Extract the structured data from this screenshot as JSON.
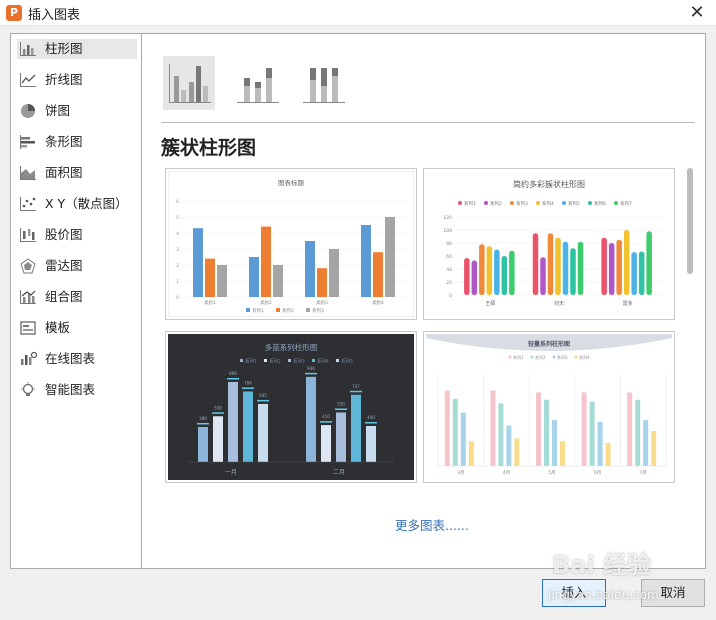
{
  "window": {
    "title": "插入图表"
  },
  "sidebar": {
    "items": [
      {
        "label": "柱形图",
        "icon": "bar-chart-icon"
      },
      {
        "label": "折线图",
        "icon": "line-chart-icon"
      },
      {
        "label": "饼图",
        "icon": "pie-chart-icon"
      },
      {
        "label": "条形图",
        "icon": "horizontal-bar-icon"
      },
      {
        "label": "面积图",
        "icon": "area-chart-icon"
      },
      {
        "label": "X Y（散点图）",
        "icon": "scatter-chart-icon"
      },
      {
        "label": "股价图",
        "icon": "stock-chart-icon"
      },
      {
        "label": "雷达图",
        "icon": "radar-chart-icon"
      },
      {
        "label": "组合图",
        "icon": "combo-chart-icon"
      },
      {
        "label": "模板",
        "icon": "template-icon"
      },
      {
        "label": "在线图表",
        "icon": "online-chart-icon"
      },
      {
        "label": "智能图表",
        "icon": "smart-chart-icon"
      }
    ],
    "selected": 0
  },
  "main": {
    "section_title": "簇状柱形图",
    "more_link": "更多图表......"
  },
  "thumbnails": [
    {
      "title": "图表标题",
      "categories": [
        "类别1",
        "类别2",
        "类别3",
        "类别4"
      ],
      "series": [
        {
          "name": "系列1",
          "values": [
            4.3,
            2.5,
            3.5,
            4.5
          ],
          "color": "#5b9bd5"
        },
        {
          "name": "系列2",
          "values": [
            2.4,
            4.4,
            1.8,
            2.8
          ],
          "color": "#ed7d31"
        },
        {
          "name": "系列3",
          "values": [
            2.0,
            2.0,
            3.0,
            5.0
          ],
          "color": "#a5a5a5"
        }
      ],
      "y_ticks": [
        "0",
        "1",
        "2",
        "3",
        "4",
        "5",
        "6"
      ],
      "ylim": [
        0,
        6
      ]
    },
    {
      "title": "简约多彩簇状柱形图",
      "legend": [
        "系列1",
        "系列2",
        "系列3",
        "系列4",
        "系列5",
        "系列6",
        "系列7"
      ],
      "colors": [
        "#e9546b",
        "#b056c9",
        "#ef8a3b",
        "#f2c12e",
        "#4bb3e6",
        "#2ec3a2",
        "#3dcc6b"
      ],
      "categories": [
        "王硕",
        "刘天",
        "雷多"
      ],
      "groups": [
        [
          57,
          53,
          78,
          75,
          70,
          60,
          68
        ],
        [
          95,
          58,
          95,
          88,
          82,
          72,
          82
        ],
        [
          88,
          80,
          85,
          100,
          66,
          67,
          98
        ]
      ],
      "y_ticks": [
        "0",
        "20",
        "40",
        "60",
        "80",
        "100",
        "120"
      ],
      "ylim": [
        0,
        120
      ]
    },
    {
      "title": "多蓝系列柱形图",
      "legend": [
        "系列1",
        "系列2",
        "系列3",
        "系列4",
        "系列5"
      ],
      "colors": [
        "#8db4da",
        "#dfe6f3",
        "#a7bedc",
        "#5eb6d8",
        "#c8dcef"
      ],
      "categories": [
        "一月",
        "二月"
      ],
      "groups": [
        [
          389,
          508,
          889,
          784,
          645
        ],
        [
          946,
          410,
          550,
          747,
          400
        ]
      ],
      "ylim": [
        0,
        1000
      ]
    },
    {
      "title": "轻量系列柱形图",
      "legend": [
        "系列1",
        "系列2",
        "系列3",
        "系列4"
      ],
      "colors": [
        "#f5c4cc",
        "#a6dcd6",
        "#a8d4ea",
        "#f8dc8c"
      ],
      "categories": [
        "3月",
        "4月",
        "5月",
        "6月",
        "7月"
      ],
      "groups": [
        [
          82,
          73,
          58,
          27
        ],
        [
          82,
          68,
          44,
          30
        ],
        [
          80,
          72,
          50,
          27
        ],
        [
          80,
          70,
          48,
          25
        ],
        [
          80,
          72,
          50,
          38
        ]
      ],
      "ylim": [
        0,
        100
      ]
    }
  ],
  "buttons": {
    "insert": "插入",
    "cancel": "取消"
  },
  "watermark": {
    "line1": "Bai 经验",
    "line2": "jingyan.baidu.com"
  }
}
